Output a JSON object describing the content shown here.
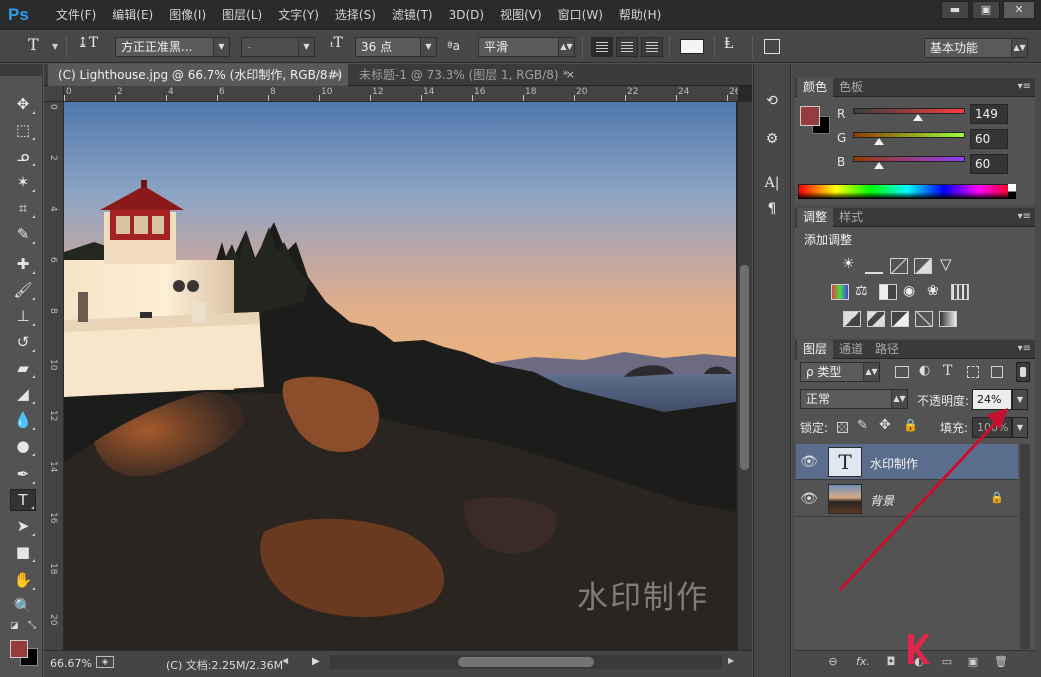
{
  "app": {
    "logo": "Ps"
  },
  "menu": [
    "文件(F)",
    "编辑(E)",
    "图像(I)",
    "图层(L)",
    "文字(Y)",
    "选择(S)",
    "滤镜(T)",
    "3D(D)",
    "视图(V)",
    "窗口(W)",
    "帮助(H)"
  ],
  "window_controls": {
    "minimize": "▬",
    "maximize": "▣",
    "close": "✕"
  },
  "options": {
    "font_family": "方正正准黑...",
    "font_style": "-",
    "font_size": "36 点",
    "aa_label": "ªa",
    "antialias": "平滑",
    "workspace": "基本功能"
  },
  "doc_tabs": [
    {
      "label": "(C) Lighthouse.jpg @ 66.7% (水印制作, RGB/8#) *",
      "close": "×"
    },
    {
      "label": "未标题-1 @ 73.3% (图层 1, RGB/8) *",
      "close": "×"
    }
  ],
  "ruler": {
    "h": [
      "0",
      "2",
      "4",
      "6",
      "8",
      "10",
      "12",
      "14",
      "16",
      "18",
      "20",
      "22",
      "24",
      "26"
    ],
    "v": [
      "0",
      "2",
      "4",
      "6",
      "8",
      "10",
      "12",
      "14",
      "16",
      "18",
      "20"
    ]
  },
  "canvas": {
    "watermark": "水印制作"
  },
  "status": {
    "zoom": "66.67%",
    "doc": "(C) 文档:2.25M/2.36M"
  },
  "color_panel": {
    "tabs": [
      "颜色",
      "色板"
    ],
    "fg_color": "#953c3c",
    "bg_color": "#000000",
    "channels": [
      {
        "label": "R",
        "value": "149",
        "fraction": 0.584
      },
      {
        "label": "G",
        "value": "60",
        "fraction": 0.235
      },
      {
        "label": "B",
        "value": "60",
        "fraction": 0.235
      }
    ]
  },
  "adjust_panel": {
    "tabs": [
      "调整",
      "样式"
    ],
    "title": "添加调整"
  },
  "layers_panel": {
    "tabs": [
      "图层",
      "通道",
      "路径"
    ],
    "filter": "ρ 类型",
    "blend_mode": "正常",
    "opacity_label": "不透明度:",
    "opacity_value": "24%",
    "lock_label": "锁定:",
    "fill_label": "填充:",
    "fill_value": "100%",
    "layers": [
      {
        "name": "水印制作",
        "thumb": "T",
        "selected": true
      },
      {
        "name": "背景",
        "selected": false
      }
    ],
    "footer": [
      "⊖",
      "fx.",
      "◘",
      "◐",
      "▭",
      "▣",
      "🗑"
    ]
  }
}
